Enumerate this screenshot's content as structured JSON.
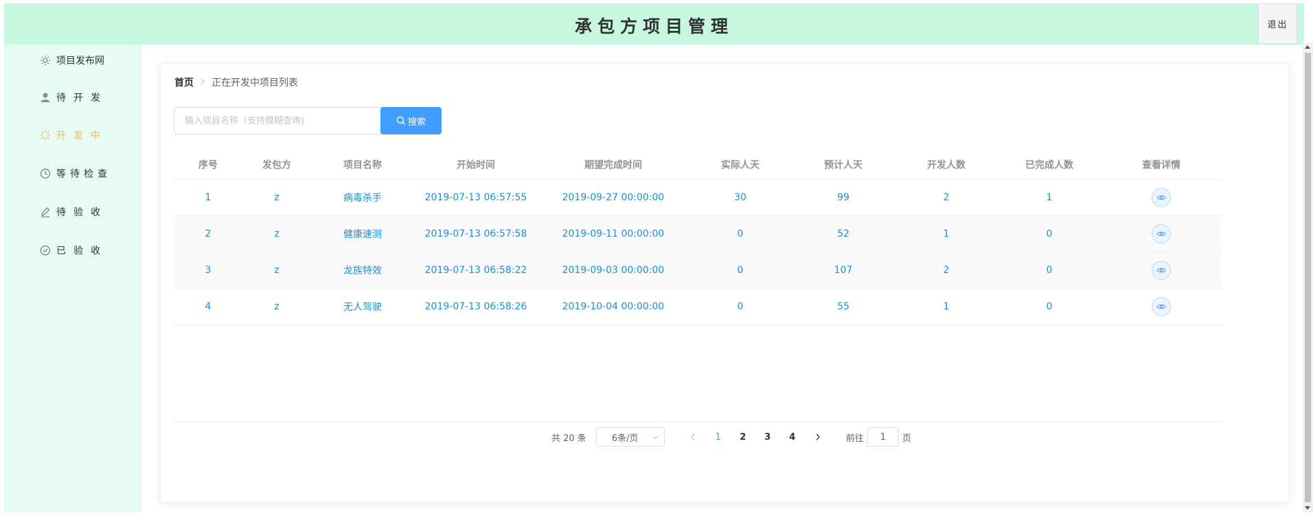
{
  "header": {
    "title": "承包方项目管理",
    "logout_label": "退出"
  },
  "sidebar": {
    "items": [
      {
        "label": "项目发布网",
        "icon": "sun-icon"
      },
      {
        "label": "待开发",
        "icon": "user-icon"
      },
      {
        "label": "开发中",
        "icon": "loading-icon",
        "active": true
      },
      {
        "label": "等待检查",
        "icon": "clock-icon"
      },
      {
        "label": "待验收",
        "icon": "edit-icon"
      },
      {
        "label": "已验收",
        "icon": "check-circle-icon"
      }
    ]
  },
  "breadcrumb": {
    "home": "首页",
    "current": "正在开发中项目列表"
  },
  "search": {
    "placeholder": "输入项目名称（支持模糊查询)",
    "value": "",
    "button_label": "搜索"
  },
  "table": {
    "headers": [
      "序号",
      "发包方",
      "项目名称",
      "开始时间",
      "期望完成时间",
      "实际人天",
      "预计人天",
      "开发人数",
      "已完成人数",
      "查看详情"
    ],
    "rows": [
      [
        "1",
        "z",
        "病毒杀手",
        "2019-07-13 06:57:55",
        "2019-09-27 00:00:00",
        "30",
        "99",
        "2",
        "1"
      ],
      [
        "2",
        "z",
        "健康速测",
        "2019-07-13 06:57:58",
        "2019-09-11 00:00:00",
        "0",
        "52",
        "1",
        "0"
      ],
      [
        "3",
        "z",
        "龙族特效",
        "2019-07-13 06:58:22",
        "2019-09-03 00:00:00",
        "0",
        "107",
        "2",
        "0"
      ],
      [
        "4",
        "z",
        "无人驾驶",
        "2019-07-13 06:58:26",
        "2019-10-04 00:00:00",
        "0",
        "55",
        "1",
        "0"
      ]
    ]
  },
  "pagination": {
    "total_label": "共 20 条",
    "page_size_label": "6条/页",
    "pages": [
      "1",
      "2",
      "3",
      "4"
    ],
    "current_page": "1",
    "goto_prefix": "前往",
    "goto_value": "1",
    "goto_suffix": "页"
  },
  "colors": {
    "header_bg": "#c8f7e0",
    "sidebar_bg": "#e6fcf2",
    "active_item": "#f5b84a",
    "primary": "#409eff",
    "link_text": "#1890d5"
  }
}
